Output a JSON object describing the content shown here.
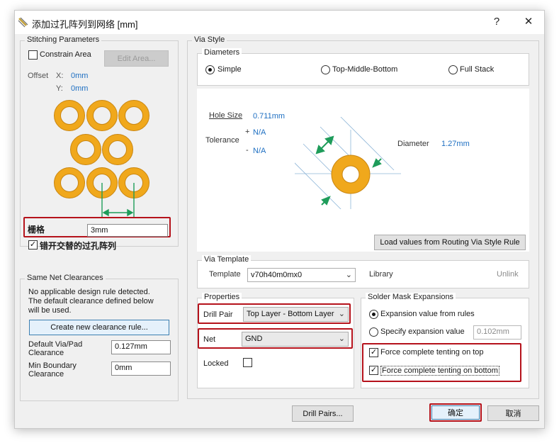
{
  "window": {
    "title": "添加过孔阵列到网络 [mm]",
    "help": "?",
    "close": "✕"
  },
  "stitching": {
    "title": "Stitching Parameters",
    "constrain_area": "Constrain Area",
    "edit_area": "Edit Area...",
    "offset_label": "Offset",
    "x_label": "X:",
    "x_value": "0mm",
    "y_label": "Y:",
    "y_value": "0mm",
    "grid_label": "栅格",
    "grid_value": "3mm",
    "stagger_label": "错开交替的过孔阵列",
    "stagger_checked": true
  },
  "clearances": {
    "title": "Same Net Clearances",
    "message": "No applicable design rule detected.\nThe default clearance defined below\nwill be used.",
    "create_button": "Create new clearance rule...",
    "default_label": "Default Via/Pad\nClearance",
    "default_value": "0.127mm",
    "min_label": "Min Boundary\nClearance",
    "min_value": "0mm"
  },
  "via_style": {
    "title": "Via Style",
    "diameters_title": "Diameters",
    "options": [
      "Simple",
      "Top-Middle-Bottom",
      "Full Stack"
    ],
    "selected": "Simple",
    "hole_size_label": "Hole Size",
    "hole_size_value": "0.711mm",
    "tolerance_label": "Tolerance",
    "tol_plus": "+",
    "tol_plus_value": "N/A",
    "tol_minus": "-",
    "tol_minus_value": "N/A",
    "diameter_label": "Diameter",
    "diameter_value": "1.27mm",
    "load_button": "Load values from Routing Via Style Rule"
  },
  "via_template": {
    "title": "Via Template",
    "template_label": "Template",
    "template_value": "v70h40m0mx0",
    "library_label": "Library",
    "unlink": "Unlink"
  },
  "properties": {
    "title": "Properties",
    "drill_pair_label": "Drill Pair",
    "drill_pair_value": "Top Layer - Bottom Layer",
    "net_label": "Net",
    "net_value": "GND",
    "locked_label": "Locked",
    "locked": false
  },
  "solder_mask": {
    "title": "Solder Mask Expansions",
    "from_rules": "Expansion value from rules",
    "specify": "Specify expansion value",
    "specify_value": "0.102mm",
    "tent_top": "Force complete tenting on top",
    "tent_bottom": "Force complete tenting on bottom",
    "tent_top_checked": true,
    "tent_bottom_checked": true
  },
  "footer": {
    "drill_pairs": "Drill Pairs...",
    "ok": "确定",
    "cancel": "取消"
  },
  "colors": {
    "via_ring": "#f0a81c",
    "via_ring_edge": "#c98612",
    "accent_green": "#1e9c5a",
    "highlight_red": "#b5121b",
    "value_blue": "#1e6fc2"
  }
}
